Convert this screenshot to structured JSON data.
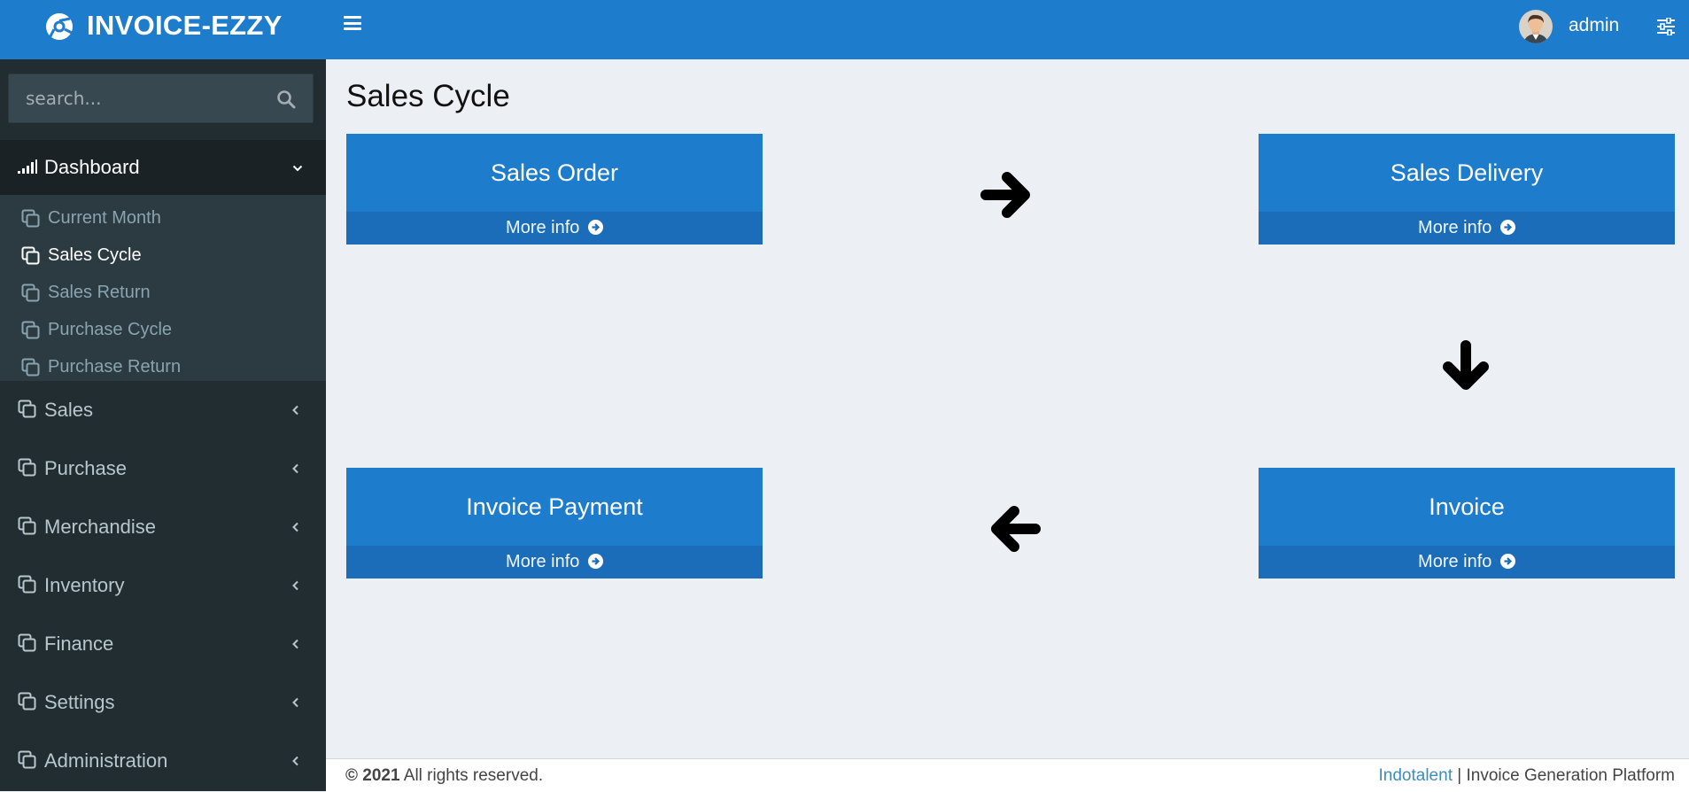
{
  "header": {
    "brand_name": "INVOICE-EZZY",
    "username": "admin"
  },
  "sidebar": {
    "search_placeholder": "search...",
    "dashboard": {
      "label": "Dashboard",
      "items": [
        {
          "label": "Current Month",
          "active": false
        },
        {
          "label": "Sales Cycle",
          "active": true
        },
        {
          "label": "Sales Return",
          "active": false
        },
        {
          "label": "Purchase Cycle",
          "active": false
        },
        {
          "label": "Purchase Return",
          "active": false
        }
      ]
    },
    "menu": [
      {
        "label": "Sales"
      },
      {
        "label": "Purchase"
      },
      {
        "label": "Merchandise"
      },
      {
        "label": "Inventory"
      },
      {
        "label": "Finance"
      },
      {
        "label": "Settings"
      },
      {
        "label": "Administration"
      }
    ]
  },
  "main": {
    "page_title": "Sales Cycle",
    "more_info_label": "More info",
    "boxes": [
      {
        "title": "Sales Order"
      },
      {
        "title": "Sales Delivery"
      },
      {
        "title": "Invoice Payment"
      },
      {
        "title": "Invoice"
      }
    ],
    "arrows": [
      "arrow-right-icon",
      "arrow-down-icon",
      "arrow-left-icon"
    ]
  },
  "footer": {
    "copyright_symbol_year": "© 2021",
    "rights": " All rights reserved.",
    "company": "Indotalent",
    "separator": " | ",
    "platform": "Invoice Generation Platform"
  },
  "colors": {
    "header_blue": "#1e7ccd",
    "sidebar_dark": "#222d32",
    "content_bg": "#ecf0f5",
    "link_blue": "#3c8dbc"
  }
}
